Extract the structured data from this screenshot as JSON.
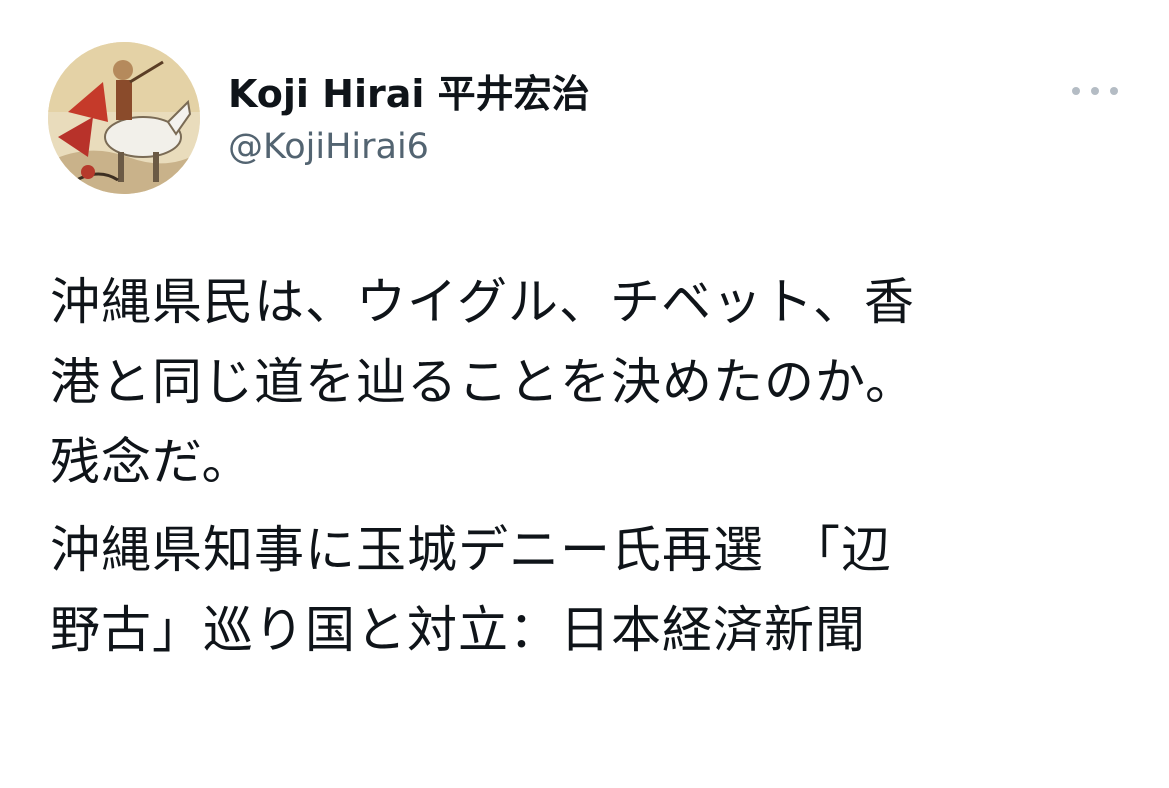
{
  "author": {
    "display_name": "Koji Hirai 平井宏治",
    "handle": "@KojiHirai6",
    "avatar_icon": "avatar-painting-icon"
  },
  "actions": {
    "more_icon": "more-horizontal-icon"
  },
  "tweet": {
    "paragraph1": [
      "沖縄県民は、ウイグル、チベット、香",
      "港と同じ道を辿ることを決めたのか。",
      "残念だ。"
    ],
    "paragraph2": [
      "沖縄県知事に玉城デニー氏再選　「辺",
      "野古」巡り国と対立：日本経済新聞"
    ]
  },
  "colors": {
    "text": "#0f1419",
    "secondary_text": "#536471",
    "dots": "#b4bcc4",
    "background": "#ffffff"
  }
}
